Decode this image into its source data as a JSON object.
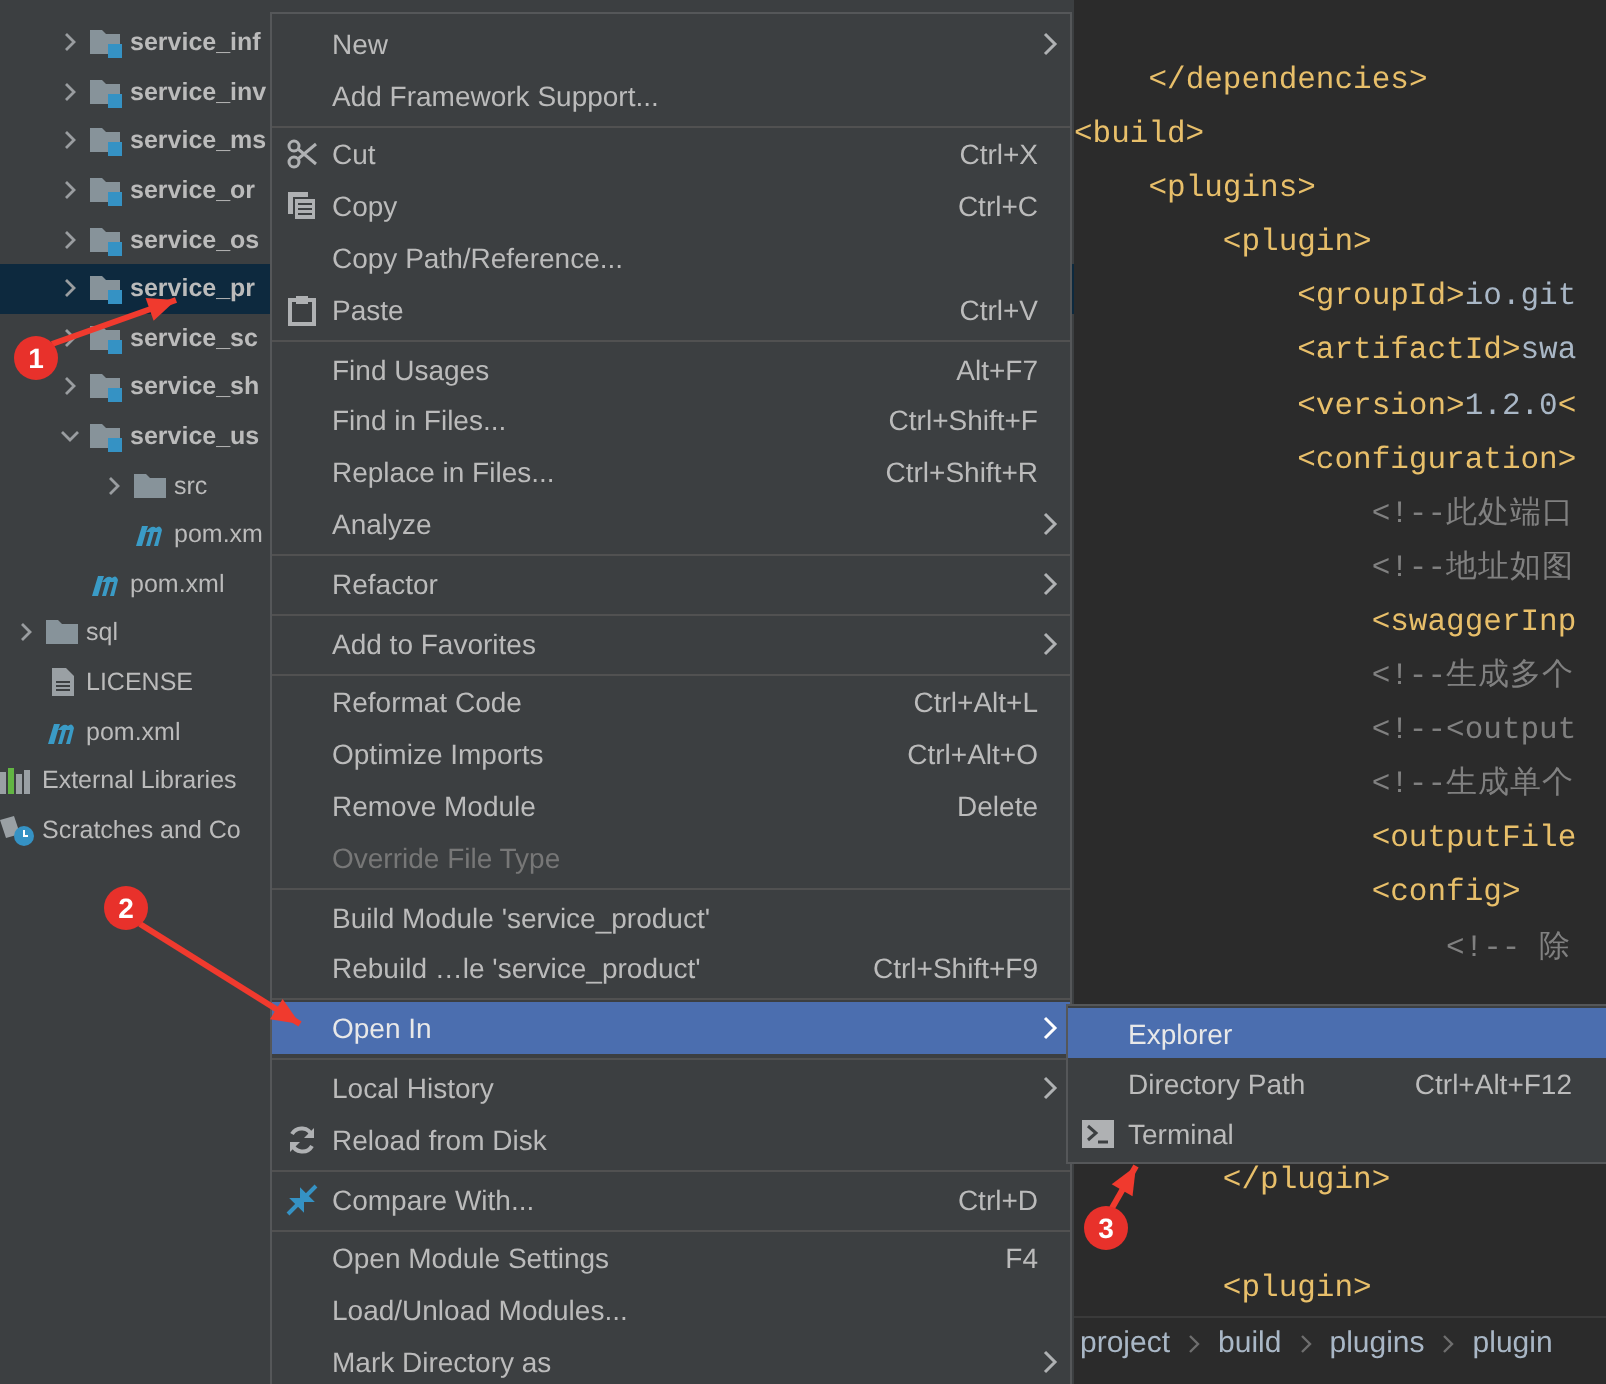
{
  "project_tree": {
    "items": [
      {
        "kind": "root",
        "children": [
          {
            "kind": "module",
            "children": [
              {
                "kind": "module",
                "label": "service_inf",
                "expanded": false,
                "selected": false
              },
              {
                "kind": "module",
                "label": "service_inv",
                "expanded": false,
                "selected": false
              },
              {
                "kind": "module",
                "label": "service_ms",
                "expanded": false,
                "selected": false
              },
              {
                "kind": "module",
                "label": "service_or",
                "expanded": false,
                "selected": false
              },
              {
                "kind": "module",
                "label": "service_os",
                "expanded": false,
                "selected": false
              },
              {
                "kind": "module",
                "label": "service_pr",
                "expanded": false,
                "selected": true
              },
              {
                "kind": "module",
                "label": "service_sc",
                "expanded": false,
                "selected": false
              },
              {
                "kind": "module",
                "label": "service_sh",
                "expanded": false,
                "selected": false
              },
              {
                "kind": "module",
                "label": "service_us",
                "expanded": true,
                "selected": false,
                "children": [
                  {
                    "kind": "folder",
                    "label": "src",
                    "expanded": false,
                    "selected": false
                  },
                  {
                    "kind": "pom",
                    "label": "pom.xm",
                    "selected": false
                  }
                ]
              },
              {
                "kind": "pom",
                "label": "pom.xml",
                "selected": false
              }
            ]
          },
          {
            "kind": "folder",
            "label": "sql",
            "expanded": false,
            "selected": false
          },
          {
            "kind": "file",
            "label": "LICENSE",
            "selected": false
          },
          {
            "kind": "pom",
            "label": "pom.xml",
            "selected": false
          }
        ]
      },
      {
        "kind": "libraries",
        "label": "External Libraries",
        "selected": false
      },
      {
        "kind": "scratches",
        "label": "Scratches and Co",
        "selected": false
      }
    ]
  },
  "editor": {
    "lines": [
      {
        "parts": [
          {
            "kind": "tag",
            "text": "    </dependencies>"
          }
        ]
      },
      {
        "parts": [
          {
            "kind": "tag",
            "text": "<build>"
          }
        ]
      },
      {
        "parts": [
          {
            "kind": "tag",
            "text": "    <plugins>"
          }
        ]
      },
      {
        "parts": [
          {
            "kind": "tag",
            "text": "        <plugin>"
          }
        ]
      },
      {
        "parts": [
          {
            "kind": "tag",
            "text": "            <groupId>"
          },
          {
            "kind": "value",
            "text": "io.git"
          }
        ]
      },
      {
        "parts": [
          {
            "kind": "tag",
            "text": "            <artifactId>"
          },
          {
            "kind": "value",
            "text": "swa"
          }
        ]
      },
      {
        "parts": [
          {
            "kind": "tag",
            "text": "            <version>"
          },
          {
            "kind": "value",
            "text": "1.2.0"
          },
          {
            "kind": "tag",
            "text": "<"
          }
        ]
      },
      {
        "parts": [
          {
            "kind": "tag",
            "text": "            <configuration>"
          }
        ]
      },
      {
        "parts": [
          {
            "kind": "comment",
            "text": "                <!--此处端口"
          }
        ]
      },
      {
        "parts": [
          {
            "kind": "comment",
            "text": "                <!--地址如图"
          }
        ]
      },
      {
        "parts": [
          {
            "kind": "tag",
            "text": "                <swaggerInp"
          }
        ]
      },
      {
        "parts": [
          {
            "kind": "comment",
            "text": "                <!--生成多个"
          }
        ]
      },
      {
        "parts": [
          {
            "kind": "comment",
            "text": "                <!--<output"
          }
        ]
      },
      {
        "parts": [
          {
            "kind": "comment",
            "text": "                <!--生成单个"
          }
        ]
      },
      {
        "parts": [
          {
            "kind": "tag",
            "text": "                <outputFile"
          }
        ]
      },
      {
        "parts": [
          {
            "kind": "tag",
            "text": "                <config>"
          }
        ]
      },
      {
        "parts": [
          {
            "kind": "comment",
            "text": "                    <!-- 除"
          }
        ]
      }
    ],
    "lines_below": [
      {
        "parts": [
          {
            "kind": "tag",
            "text": "        </plugin>"
          }
        ]
      },
      {
        "parts": [
          {
            "kind": "tag",
            "text": "        <plugin>"
          }
        ]
      }
    ],
    "breadcrumbs": [
      "project",
      "build",
      "plugins",
      "plugin"
    ]
  },
  "context_menu": {
    "items": [
      {
        "kind": "item",
        "label": "New",
        "submenu": true,
        "disabled": false,
        "selected": false
      },
      {
        "kind": "item",
        "label": "Add Framework Support...",
        "submenu": false,
        "disabled": false,
        "selected": false
      },
      {
        "kind": "separator"
      },
      {
        "kind": "item",
        "label": "Cut",
        "shortcut": "Ctrl+X",
        "submenu": false,
        "disabled": false,
        "selected": false
      },
      {
        "kind": "item",
        "label": "Copy",
        "shortcut": "Ctrl+C",
        "submenu": false,
        "disabled": false,
        "selected": false
      },
      {
        "kind": "item",
        "label": "Copy Path/Reference...",
        "submenu": false,
        "disabled": false,
        "selected": false
      },
      {
        "kind": "item",
        "label": "Paste",
        "shortcut": "Ctrl+V",
        "submenu": false,
        "disabled": false,
        "selected": false
      },
      {
        "kind": "separator"
      },
      {
        "kind": "item",
        "label": "Find Usages",
        "shortcut": "Alt+F7",
        "submenu": false,
        "disabled": false,
        "selected": false
      },
      {
        "kind": "item",
        "label": "Find in Files...",
        "shortcut": "Ctrl+Shift+F",
        "submenu": false,
        "disabled": false,
        "selected": false
      },
      {
        "kind": "item",
        "label": "Replace in Files...",
        "shortcut": "Ctrl+Shift+R",
        "submenu": false,
        "disabled": false,
        "selected": false
      },
      {
        "kind": "item",
        "label": "Analyze",
        "submenu": true,
        "disabled": false,
        "selected": false
      },
      {
        "kind": "separator"
      },
      {
        "kind": "item",
        "label": "Refactor",
        "submenu": true,
        "disabled": false,
        "selected": false
      },
      {
        "kind": "separator"
      },
      {
        "kind": "item",
        "label": "Add to Favorites",
        "submenu": true,
        "disabled": false,
        "selected": false
      },
      {
        "kind": "separator"
      },
      {
        "kind": "item",
        "label": "Reformat Code",
        "shortcut": "Ctrl+Alt+L",
        "submenu": false,
        "disabled": false,
        "selected": false
      },
      {
        "kind": "item",
        "label": "Optimize Imports",
        "shortcut": "Ctrl+Alt+O",
        "submenu": false,
        "disabled": false,
        "selected": false
      },
      {
        "kind": "item",
        "label": "Remove Module",
        "shortcut": "Delete",
        "submenu": false,
        "disabled": false,
        "selected": false
      },
      {
        "kind": "item",
        "label": "Override File Type",
        "submenu": false,
        "disabled": true,
        "selected": false
      },
      {
        "kind": "separator"
      },
      {
        "kind": "item",
        "label": "Build Module 'service_product'",
        "submenu": false,
        "disabled": false,
        "selected": false
      },
      {
        "kind": "item",
        "label": "Rebuild …le 'service_product'",
        "shortcut": "Ctrl+Shift+F9",
        "submenu": false,
        "disabled": false,
        "selected": false
      },
      {
        "kind": "separator"
      },
      {
        "kind": "item",
        "label": "Open In",
        "submenu": true,
        "disabled": false,
        "selected": true
      },
      {
        "kind": "separator"
      },
      {
        "kind": "item",
        "label": "Local History",
        "submenu": true,
        "disabled": false,
        "selected": false
      },
      {
        "kind": "item",
        "label": "Reload from Disk",
        "submenu": false,
        "disabled": false,
        "selected": false
      },
      {
        "kind": "separator"
      },
      {
        "kind": "item",
        "label": "Compare With...",
        "shortcut": "Ctrl+D",
        "submenu": false,
        "disabled": false,
        "selected": false
      },
      {
        "kind": "separator"
      },
      {
        "kind": "item",
        "label": "Open Module Settings",
        "shortcut": "F4",
        "submenu": false,
        "disabled": false,
        "selected": false
      },
      {
        "kind": "item",
        "label": "Load/Unload Modules...",
        "submenu": false,
        "disabled": false,
        "selected": false
      },
      {
        "kind": "item",
        "label": "Mark Directory as",
        "submenu": true,
        "disabled": false,
        "selected": false
      }
    ]
  },
  "submenu": {
    "items": [
      {
        "label": "Explorer",
        "selected": true
      },
      {
        "label": "Directory Path",
        "shortcut": "Ctrl+Alt+F12",
        "selected": false
      },
      {
        "label": "Terminal",
        "selected": false
      }
    ]
  },
  "annotations": [
    {
      "label": "1"
    },
    {
      "label": "2"
    },
    {
      "label": "3"
    }
  ]
}
